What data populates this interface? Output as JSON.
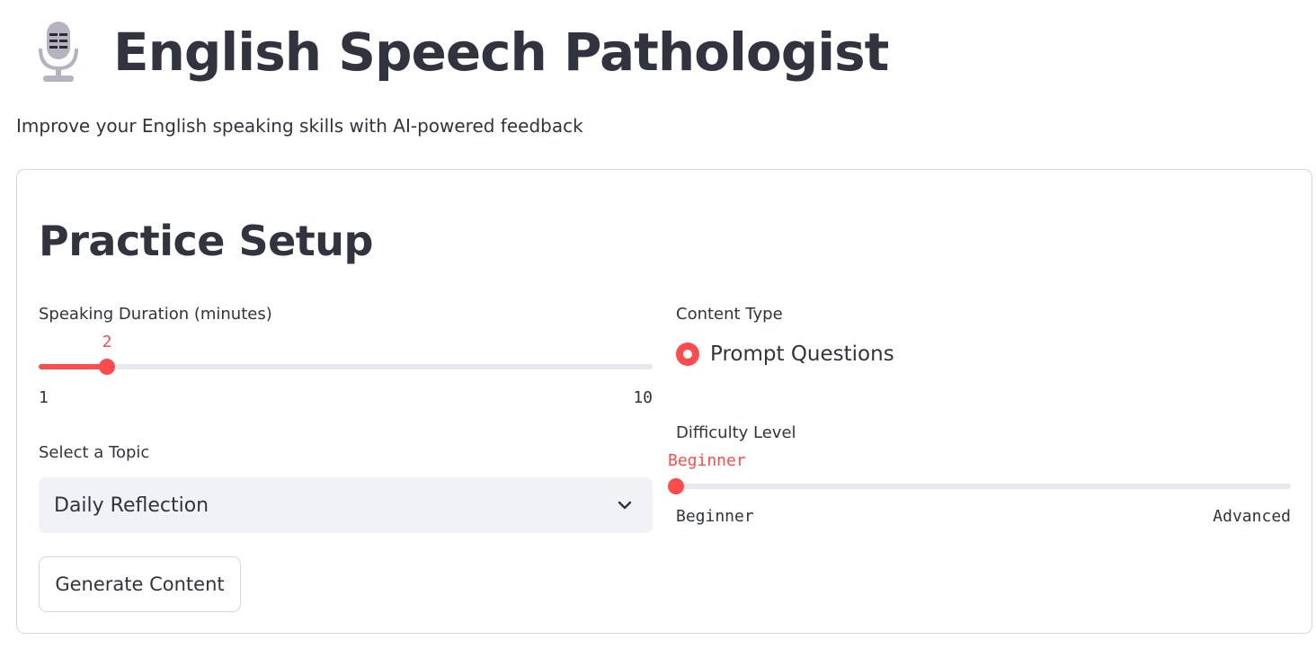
{
  "header": {
    "icon": "microphone-icon",
    "title": "English Speech Pathologist",
    "subtitle": "Improve your English speaking skills with AI-powered feedback"
  },
  "practice_setup": {
    "title": "Practice Setup",
    "duration": {
      "label": "Speaking Duration (minutes)",
      "value": "2",
      "min": "1",
      "max": "10",
      "fraction": 0.1111
    },
    "topic": {
      "label": "Select a Topic",
      "selected": "Daily Reflection"
    },
    "generate_button": "Generate Content",
    "content_type": {
      "label": "Content Type",
      "options": [
        "Prompt Questions"
      ],
      "selected": "Prompt Questions"
    },
    "difficulty": {
      "label": "Difficulty Level",
      "value": "Beginner",
      "min": "Beginner",
      "max": "Advanced",
      "fraction": 0
    }
  },
  "colors": {
    "accent": "#ff4b4b",
    "text": "#31333f",
    "track": "#e6e8ed",
    "select_bg": "#f0f2f6",
    "border": "#d6d8de"
  }
}
